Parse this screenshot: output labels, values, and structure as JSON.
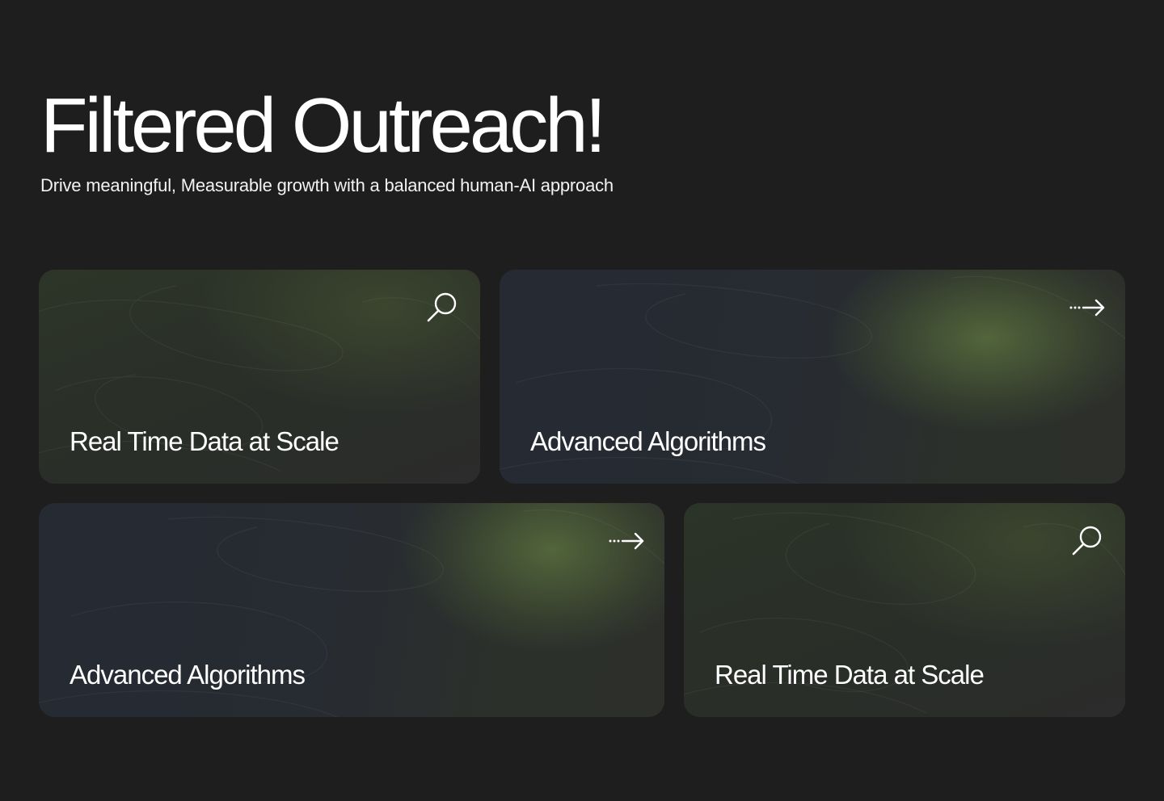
{
  "hero": {
    "title": "Filtered Outreach!",
    "subtitle": "Drive meaningful, Measurable growth with a balanced human-AI approach"
  },
  "cards": [
    {
      "title": "Real Time Data at Scale",
      "icon": "search-icon"
    },
    {
      "title": "Advanced Algorithms",
      "icon": "dotted-arrow-right-icon"
    },
    {
      "title": "Advanced Algorithms",
      "icon": "dotted-arrow-right-icon"
    },
    {
      "title": "Real Time Data at Scale",
      "icon": "search-icon"
    }
  ],
  "colors": {
    "background": "#1e1e1e",
    "text": "#ffffff",
    "accent_green": "#546838",
    "card_dark": "#2a2d2a",
    "card_blue": "#252a33"
  }
}
